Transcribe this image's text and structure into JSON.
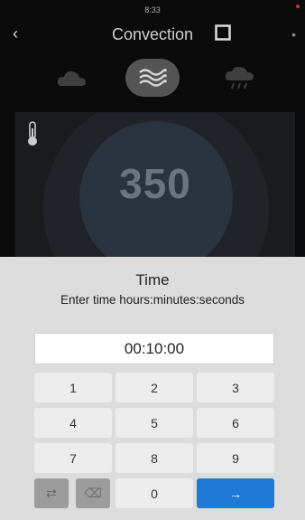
{
  "status": {
    "time": "8:33"
  },
  "header": {
    "title": "Convection"
  },
  "modes": {
    "left": "cloud",
    "center": "waves",
    "right": "cloud-rain"
  },
  "temperature": {
    "value": "350"
  },
  "dialog": {
    "title": "Time",
    "subtitle": "Enter time hours:minutes:seconds",
    "value": "00:10:00"
  },
  "keypad": {
    "row1": [
      "1",
      "2",
      "3"
    ],
    "row2": [
      "4",
      "5",
      "6"
    ],
    "row3": [
      "7",
      "8",
      "9"
    ],
    "row4": {
      "key_a": "⇄",
      "key_b": "⌫",
      "zero": "0",
      "enter": "→"
    }
  },
  "colors": {
    "accent": "#1e7ad6",
    "sheet": "#dcdcdc"
  }
}
